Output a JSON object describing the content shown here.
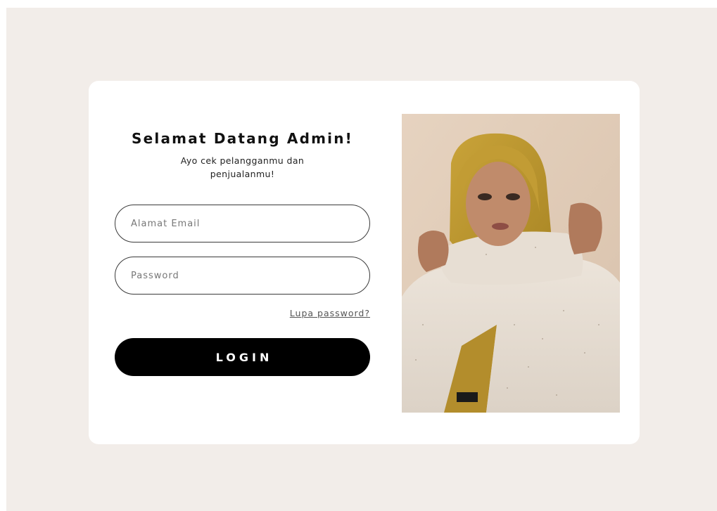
{
  "login": {
    "title": "Selamat Datang Admin!",
    "subtitle": "Ayo cek pelangganmu dan penjualanmu!",
    "email_placeholder": "Alamat Email",
    "password_placeholder": "Password",
    "forgot_label": "Lupa password?",
    "login_label": "LOGIN"
  },
  "colors": {
    "page_background": "#f2ede9",
    "card_background": "#ffffff",
    "button_background": "#000000",
    "button_text": "#ffffff"
  }
}
